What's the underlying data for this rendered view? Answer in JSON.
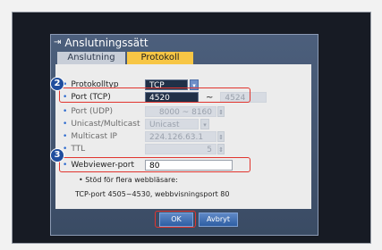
{
  "dialog": {
    "title": "Anslutningssätt",
    "title_icon": "connection-icon"
  },
  "tabs": [
    {
      "label": "Anslutning",
      "active": false
    },
    {
      "label": "Protokoll",
      "active": true
    }
  ],
  "fields": {
    "protocol_type": {
      "label": "Protokolltyp",
      "value": "TCP"
    },
    "port_tcp": {
      "label": "Port (TCP)",
      "value": "4520",
      "end_value": "4524"
    },
    "port_udp": {
      "label": "Port (UDP)",
      "value": "8000 ~ 8160"
    },
    "unicast_multicast": {
      "label": "Unicast/Multicast",
      "value": "Unicast"
    },
    "multicast_ip": {
      "label": "Multicast IP",
      "value": "224.126.63.1"
    },
    "ttl": {
      "label": "TTL",
      "value": "5"
    },
    "webviewer_port": {
      "label": "Webviewer-port",
      "value": "80"
    }
  },
  "notes": {
    "heading": "• Stöd för flera webbläsare:",
    "detail": "TCP-port 4505~4530, webbvisningsport 80"
  },
  "buttons": {
    "ok": "OK",
    "cancel": "Avbryt"
  },
  "annotations": {
    "badge_2": "2",
    "badge_3": "3"
  },
  "colors": {
    "accent_tab": "#f7c645",
    "highlight": "#e1352e",
    "dialog_blue": "#4c5f7c"
  }
}
